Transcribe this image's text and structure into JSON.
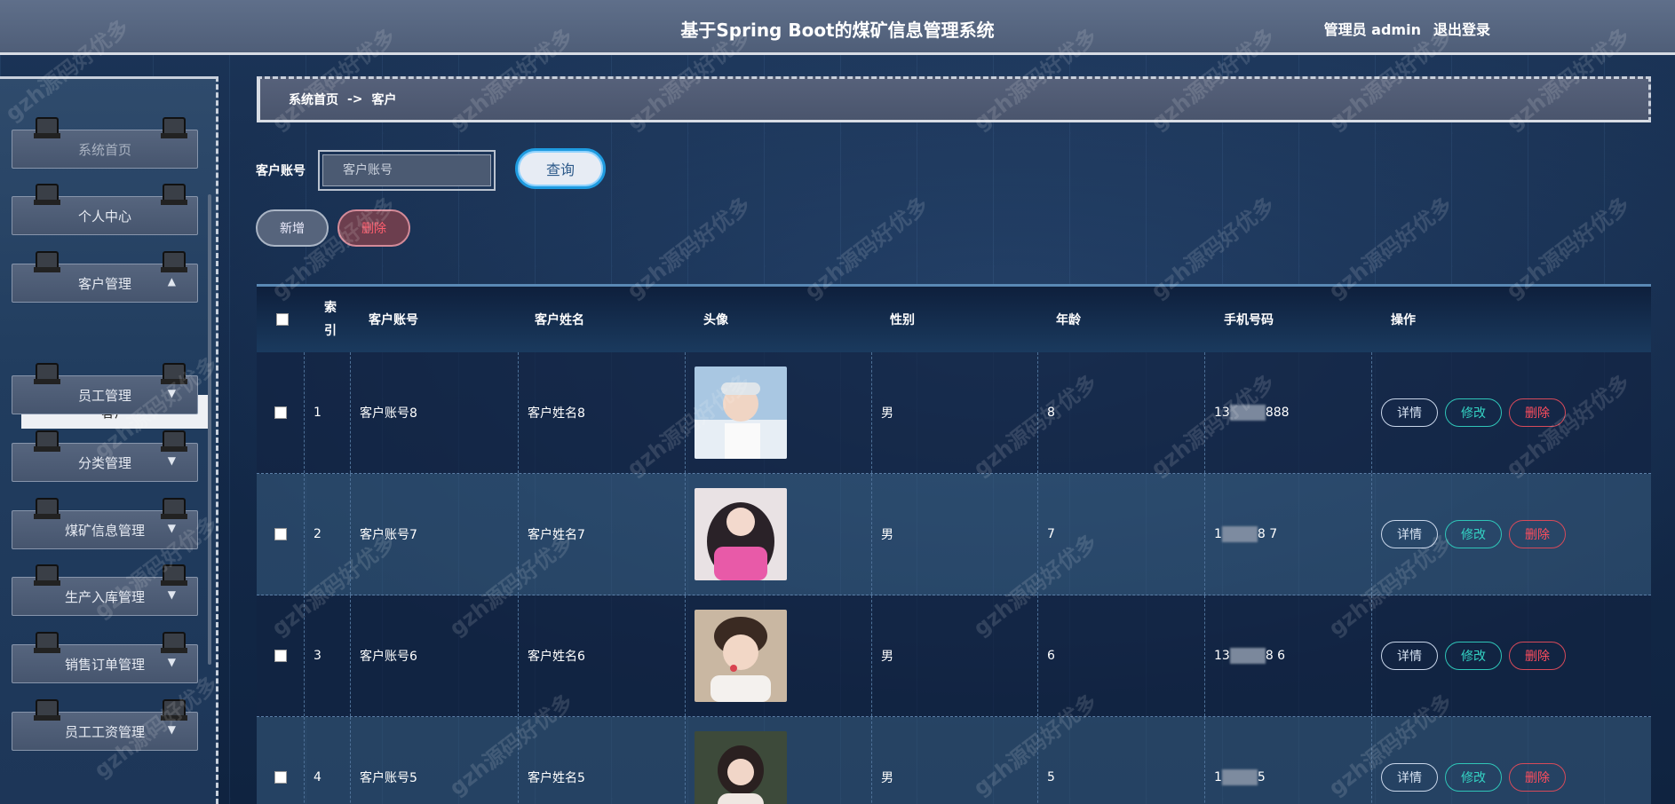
{
  "header": {
    "title": "基于Spring Boot的煤矿信息管理系统",
    "user": "管理员 admin",
    "logout": "退出登录"
  },
  "sidebar": {
    "items": [
      {
        "label": "系统首页"
      },
      {
        "label": "个人中心"
      },
      {
        "label": "客户管理",
        "chevron": "chevron-up-icon"
      },
      {
        "label": "员工管理",
        "chevron": "chevron-down-icon"
      },
      {
        "label": "分类管理",
        "chevron": "chevron-down-icon"
      },
      {
        "label": "煤矿信息管理",
        "chevron": "chevron-down-icon"
      },
      {
        "label": "生产入库管理",
        "chevron": "chevron-down-icon"
      },
      {
        "label": "销售订单管理",
        "chevron": "chevron-down-icon"
      },
      {
        "label": "员工工资管理",
        "chevron": "chevron-down-icon"
      }
    ],
    "sub_active": "客户"
  },
  "breadcrumb": {
    "home": "系统首页",
    "sep": "->",
    "current": "客户"
  },
  "search": {
    "label": "客户账号",
    "placeholder": "客户账号",
    "button": "查询"
  },
  "actions": {
    "add": "新增",
    "delete": "删除"
  },
  "table": {
    "headers": {
      "index": "索引",
      "account": "客户账号",
      "name": "客户姓名",
      "avatar": "头像",
      "gender": "性别",
      "age": "年龄",
      "phone": "手机号码",
      "ops": "操作"
    },
    "row_ops": {
      "detail": "详情",
      "edit": "修改",
      "remove": "删除"
    },
    "rows": [
      {
        "index": "1",
        "account": "客户账号8",
        "name": "客户姓名8",
        "gender": "男",
        "age": "8",
        "phone_head": "13",
        "phone_tail": "888"
      },
      {
        "index": "2",
        "account": "客户账号7",
        "name": "客户姓名7",
        "gender": "男",
        "age": "7",
        "phone_head": "1",
        "phone_tail": "8  7"
      },
      {
        "index": "3",
        "account": "客户账号6",
        "name": "客户姓名6",
        "gender": "男",
        "age": "6",
        "phone_head": "13",
        "phone_tail": "8  6"
      },
      {
        "index": "4",
        "account": "客户账号5",
        "name": "客户姓名5",
        "gender": "男",
        "age": "5",
        "phone_head": "1",
        "phone_tail": "5"
      }
    ]
  },
  "watermark": "gzh源码好优多"
}
